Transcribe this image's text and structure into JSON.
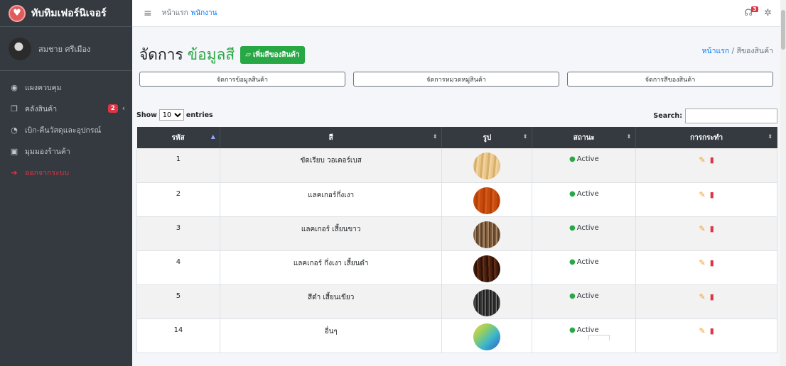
{
  "brand": {
    "name": "ทับทิมเฟอร์นิเจอร์",
    "logo_icon": "heart-icon"
  },
  "user": {
    "name": "สมชาย ศรีเมือง"
  },
  "sidebar": {
    "items": [
      {
        "icon": "dashboard-icon",
        "glyph": "◉",
        "label": "แผงควบคุม"
      },
      {
        "icon": "copy-icon",
        "glyph": "❐",
        "label": "คลังสินค้า",
        "badge": "2"
      },
      {
        "icon": "pie-chart-icon",
        "glyph": "◔",
        "label": "เบิก-คืนวัสดุและอุปกรณ์"
      },
      {
        "icon": "image-icon",
        "glyph": "▣",
        "label": "มุมมองร้านค้า"
      },
      {
        "icon": "sign-out-icon",
        "glyph": "➜",
        "label": "ออกจากระบบ"
      }
    ]
  },
  "topbar": {
    "home": "หน้าแรก",
    "staff": "พนักงาน",
    "chat_badge": "3"
  },
  "page": {
    "title": "จัดการ",
    "title_accent": "ข้อมูลสี",
    "add_button": "เพิ่มสีของสินค้า",
    "breadcrumb": {
      "home": "หน้าแรก",
      "separator": "/",
      "current": "สีของสินค้า"
    }
  },
  "tabs": [
    "จัดการข้อมูลสินค้า",
    "จัดการหมวดหมู่สินค้า",
    "จัดการสีของสินค้า"
  ],
  "table_controls": {
    "show": "Show",
    "entries_value": "10",
    "entries": "entries",
    "search": "Search:"
  },
  "table": {
    "headers": [
      "รหัส",
      "สี",
      "รูป",
      "สถานะ",
      "การกระทำ"
    ],
    "rows": [
      {
        "id": "1",
        "name": "ขัดเรียบ วอเตอร์เบส",
        "status": "Active",
        "swatch": "light-wood"
      },
      {
        "id": "2",
        "name": "แลคเกอร์กึ่งเงา",
        "status": "Active",
        "swatch": "orange-wood"
      },
      {
        "id": "3",
        "name": "แลคเกอร์ เสี้ยนขาว",
        "status": "Active",
        "swatch": "brown-wood"
      },
      {
        "id": "4",
        "name": "แลคเกอร์ กึ่งเงา เสี้ยนดำ",
        "status": "Active",
        "swatch": "dark-wood"
      },
      {
        "id": "5",
        "name": "สีดำ เสี้ยนเขียว",
        "status": "Active",
        "swatch": "black-grain"
      },
      {
        "id": "14",
        "name": "อื่นๆ",
        "status": "Active",
        "swatch": "rainbow"
      }
    ]
  },
  "colors": {
    "accent": "#28a745",
    "sidebar": "#343a40",
    "danger": "#dc3545",
    "link": "#007bff"
  }
}
